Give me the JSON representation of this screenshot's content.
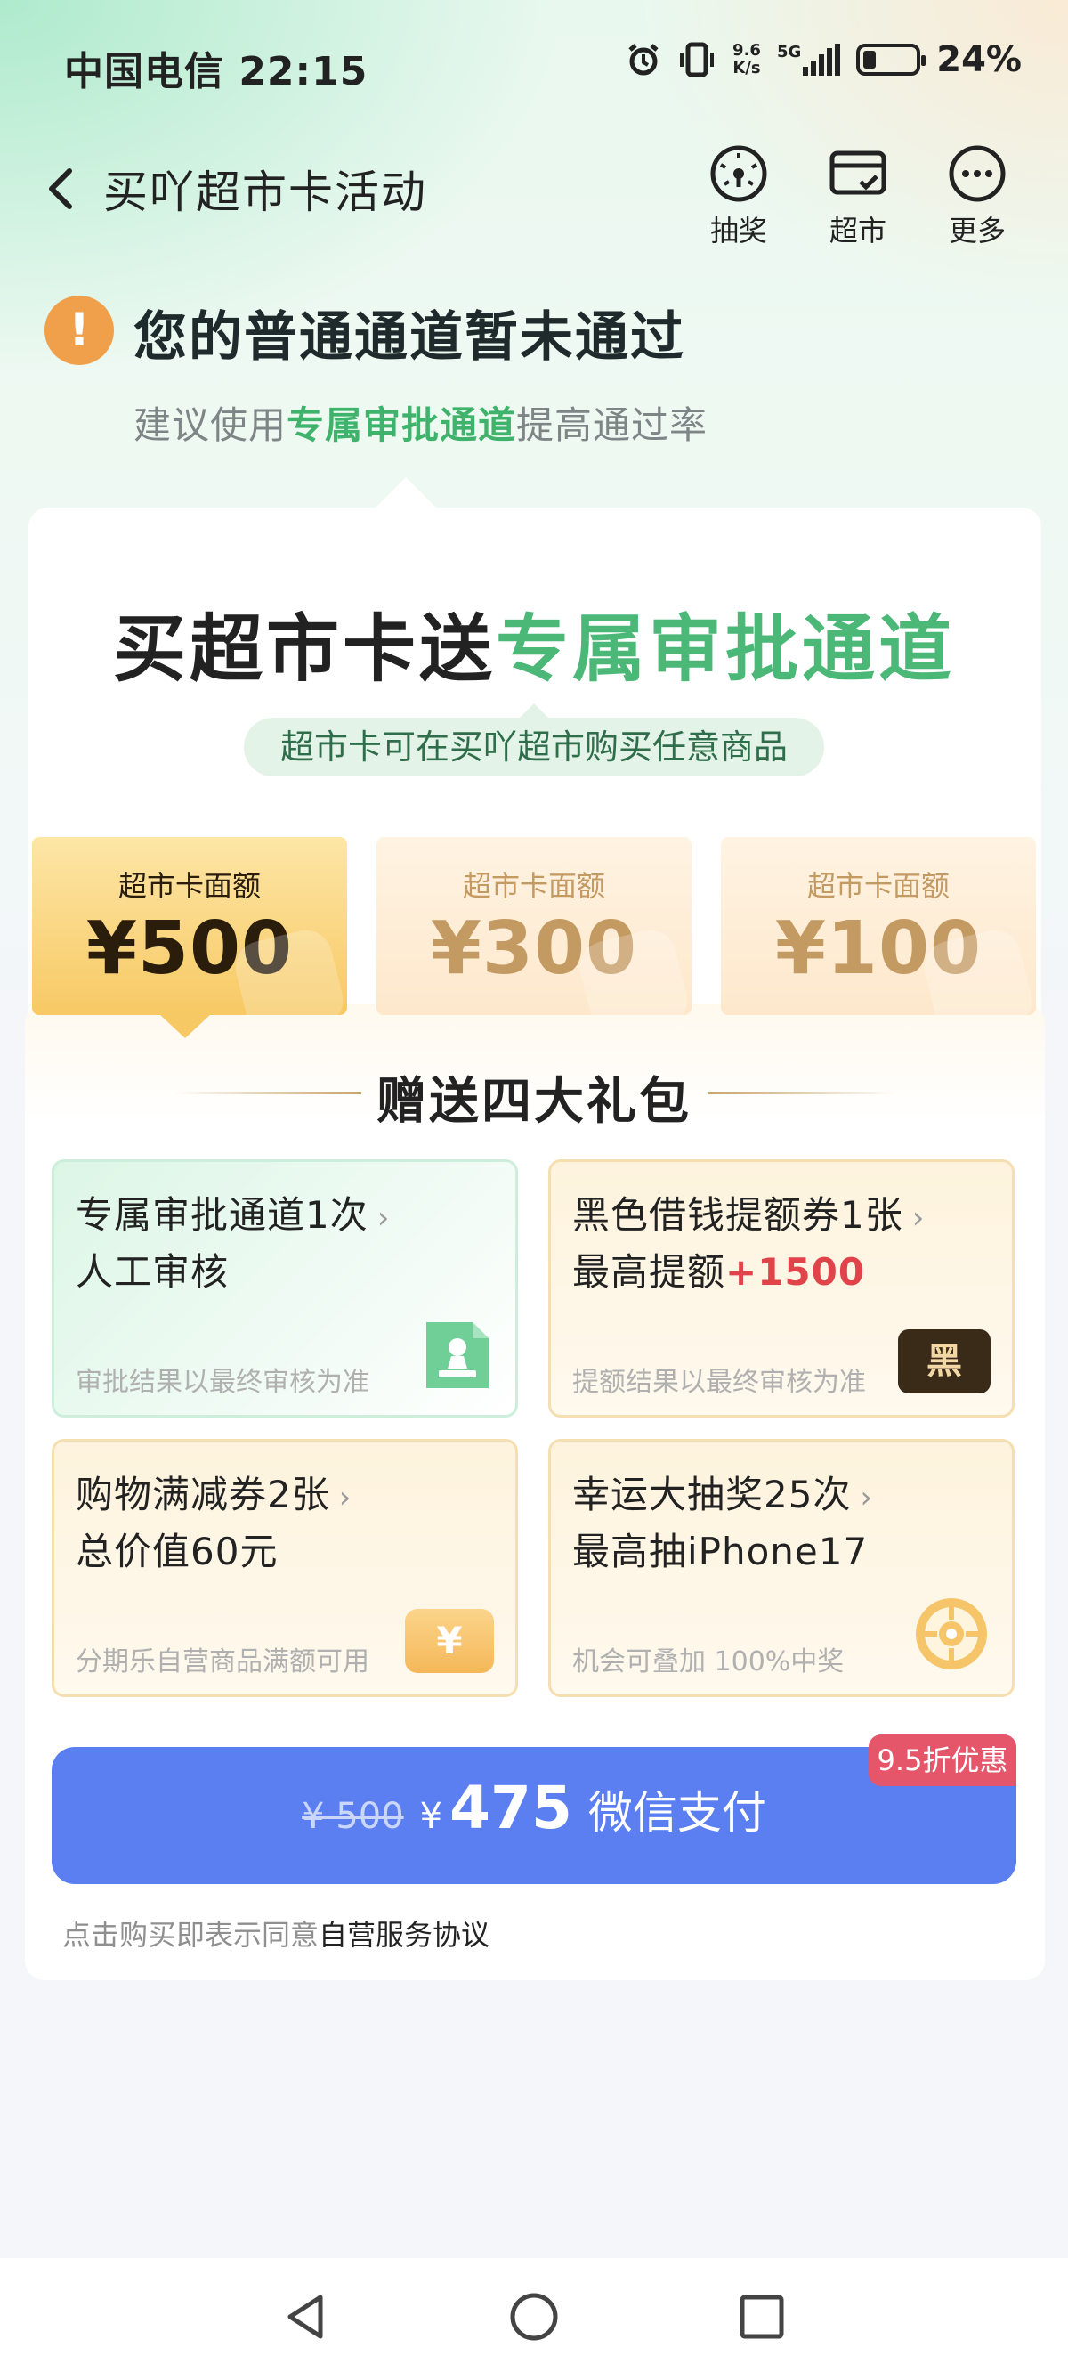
{
  "status_bar": {
    "carrier_time": "中国电信 22:15",
    "net_speed_top": "9.6",
    "net_speed_bottom": "K/s",
    "network": "5G",
    "battery": "24%",
    "battery_level": 0.24
  },
  "header": {
    "title": "买吖超市卡活动",
    "actions": [
      {
        "label": "抽奖",
        "icon": "dial-icon"
      },
      {
        "label": "超市",
        "icon": "card-icon"
      },
      {
        "label": "更多",
        "icon": "more-icon"
      }
    ]
  },
  "notice": {
    "icon_glyph": "!",
    "title": "您的普通通道暂未通过",
    "sub_before": "建议使用",
    "sub_highlight": "专属审批通道",
    "sub_after": "提高通过率"
  },
  "promo": {
    "title_a": "买超市卡送",
    "title_b": "专属审批通道",
    "pill": "超市卡可在买吖超市购买任意商品"
  },
  "denominations": [
    {
      "label": "超市卡面额",
      "amount": "¥500",
      "selected": true
    },
    {
      "label": "超市卡面额",
      "amount": "¥300",
      "selected": false
    },
    {
      "label": "超市卡面额",
      "amount": "¥100",
      "selected": false
    }
  ],
  "gifts": {
    "title": "赠送四大礼包",
    "items": [
      {
        "line1": "专属审批通道1次",
        "line2": "人工审核",
        "line2_highlight": "",
        "note": "审批结果以最终审核为准",
        "icon": "approval-stamp-icon"
      },
      {
        "line1": "黑色借钱提额券1张",
        "line2": "最高提额",
        "line2_highlight": "+1500",
        "note": "提额结果以最终审核为准",
        "icon": "black-coupon-icon",
        "icon_text": "黑"
      },
      {
        "line1": "购物满减券2张",
        "line2": "总价值60元",
        "line2_highlight": "",
        "note": "分期乐自营商品满额可用",
        "icon": "yen-coupon-icon",
        "icon_text": "¥"
      },
      {
        "line1": "幸运大抽奖25次",
        "line2": "最高抽iPhone17",
        "line2_highlight": "",
        "note": "机会可叠加 100%中奖",
        "icon": "prize-wheel-icon"
      }
    ],
    "chevron": "›"
  },
  "payment": {
    "discount_badge": "9.5折优惠",
    "original_price": "¥ 500",
    "currency": "¥",
    "price": "475",
    "method": "微信支付",
    "agree_prefix": "点击购买即表示同意",
    "agree_link": "自营服务协议"
  },
  "colors": {
    "accent_green": "#4cb878",
    "pay_blue": "#5b7ff0",
    "badge_pink": "#e5566b",
    "warn_orange": "#f0a04b",
    "gold": "#f7c964"
  }
}
